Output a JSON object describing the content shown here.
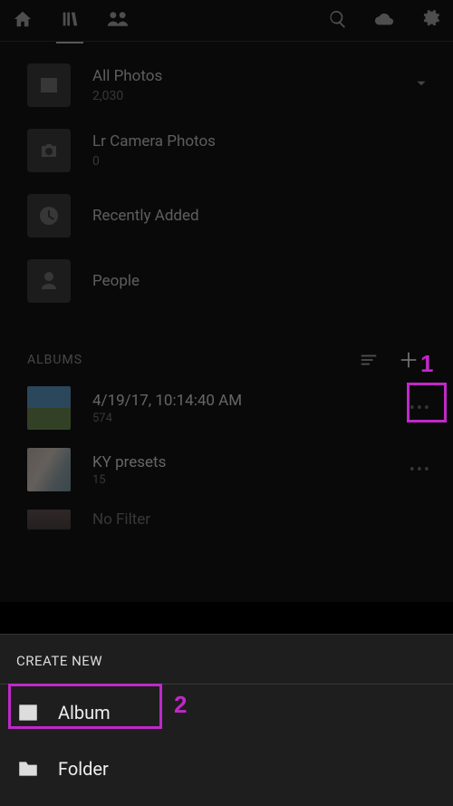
{
  "library": {
    "items": [
      {
        "title": "All Photos",
        "count": "2,030",
        "icon": "image"
      },
      {
        "title": "Lr Camera Photos",
        "count": "0",
        "icon": "camera"
      },
      {
        "title": "Recently Added",
        "count": "",
        "icon": "clock"
      },
      {
        "title": "People",
        "count": "",
        "icon": "person"
      }
    ]
  },
  "albums": {
    "header": "ALBUMS",
    "items": [
      {
        "title": "4/19/17, 10:14:40 AM",
        "count": "574"
      },
      {
        "title": "KY presets",
        "count": "15"
      },
      {
        "title": "No Filter",
        "count": ""
      }
    ]
  },
  "sheet": {
    "header": "CREATE NEW",
    "options": [
      {
        "label": "Album",
        "icon": "image"
      },
      {
        "label": "Folder",
        "icon": "folder"
      }
    ]
  },
  "annotations": {
    "one": "1",
    "two": "2"
  }
}
